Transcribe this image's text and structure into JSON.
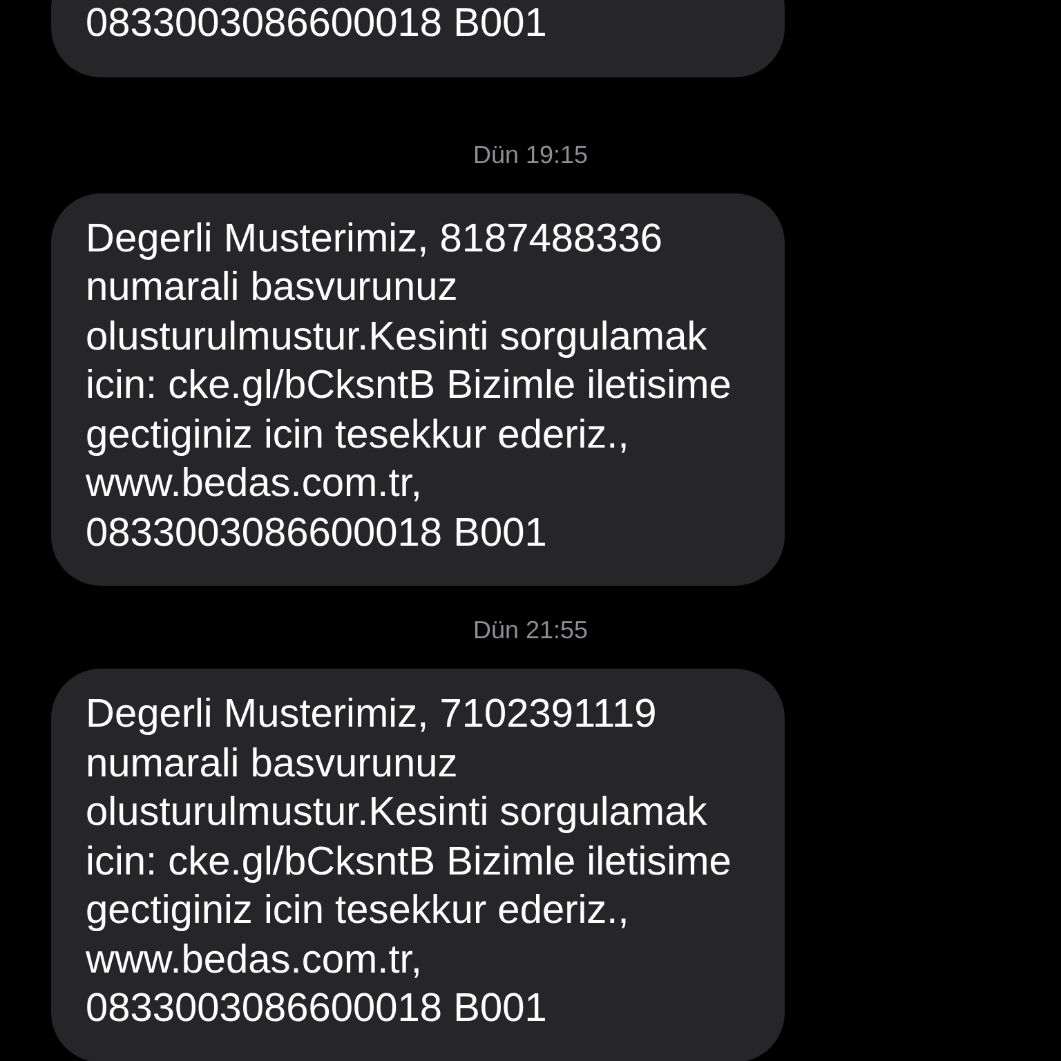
{
  "messages": [
    {
      "parts": [
        {
          "text": "0833003086600018 B001",
          "kind": "text"
        }
      ]
    },
    {
      "time": "Dün 19:15",
      "parts": [
        {
          "text": "Degerli Musterimiz, ",
          "kind": "text"
        },
        {
          "text": "8187488336",
          "kind": "link"
        },
        {
          "text": " numarali basvurunuz olusturulmustur.Kesinti sorgulamak icin: ",
          "kind": "text"
        },
        {
          "text": "cke.gl/bCksntB",
          "kind": "link"
        },
        {
          "text": " Bizimle iletisime gectiginiz icin tesekkur ederiz., ",
          "kind": "text"
        },
        {
          "text": "www.bedas.com.tr",
          "kind": "link"
        },
        {
          "text": ", 0833003086600018 B001",
          "kind": "text"
        }
      ]
    },
    {
      "time": "Dün 21:55",
      "parts": [
        {
          "text": "Degerli Musterimiz, ",
          "kind": "text"
        },
        {
          "text": "7102391119",
          "kind": "link"
        },
        {
          "text": " numarali basvurunuz olusturulmustur.Kesinti sorgulamak icin: ",
          "kind": "text"
        },
        {
          "text": "cke.gl/bCksntB",
          "kind": "link"
        },
        {
          "text": " Bizimle iletisime gectiginiz icin tesekkur ederiz., ",
          "kind": "text"
        },
        {
          "text": "www.bedas.com.tr",
          "kind": "link"
        },
        {
          "text": ", 0833003086600018 B001",
          "kind": "text"
        }
      ]
    }
  ]
}
